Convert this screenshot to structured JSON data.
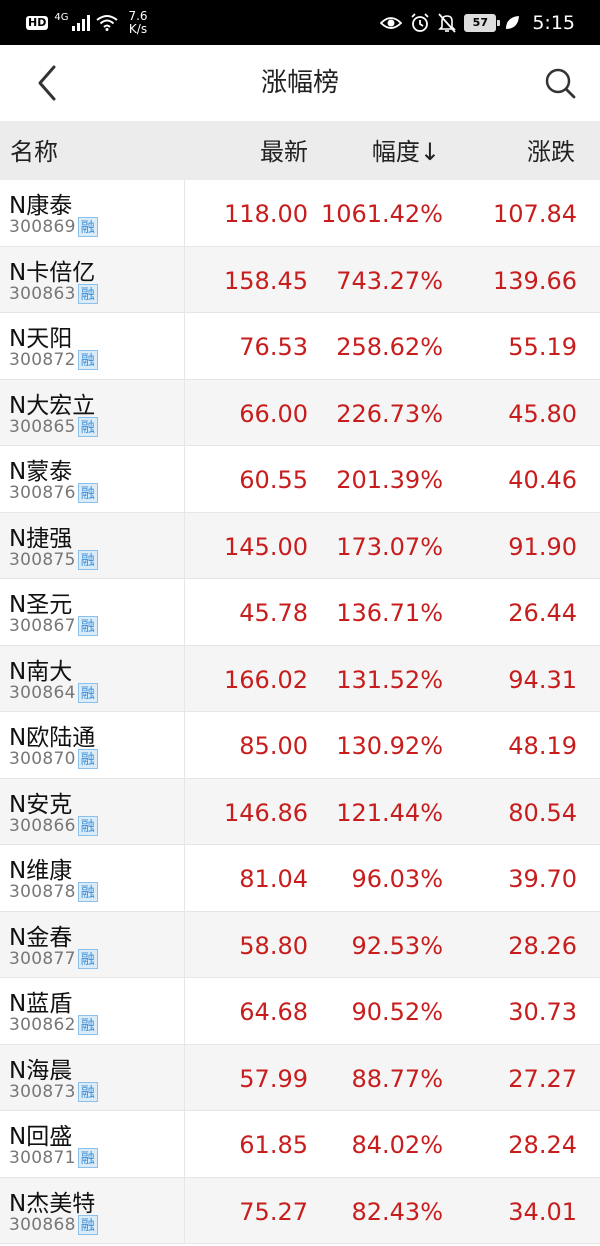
{
  "status_bar": {
    "hd": "HD",
    "network": "4G",
    "speed_value": "7.6",
    "speed_unit": "K/s",
    "battery": "57",
    "time": "5:15"
  },
  "header": {
    "title": "涨幅榜",
    "back_icon": "chevron-left-icon",
    "search_icon": "search-icon"
  },
  "columns": {
    "name": "名称",
    "latest": "最新",
    "change": "幅度↓",
    "diff": "涨跌"
  },
  "badge_label": "融",
  "rows": [
    {
      "name": "N康泰",
      "code": "300869",
      "latest": "118.00",
      "change": "1061.42%",
      "diff": "107.84"
    },
    {
      "name": "N卡倍亿",
      "code": "300863",
      "latest": "158.45",
      "change": "743.27%",
      "diff": "139.66"
    },
    {
      "name": "N天阳",
      "code": "300872",
      "latest": "76.53",
      "change": "258.62%",
      "diff": "55.19"
    },
    {
      "name": "N大宏立",
      "code": "300865",
      "latest": "66.00",
      "change": "226.73%",
      "diff": "45.80"
    },
    {
      "name": "N蒙泰",
      "code": "300876",
      "latest": "60.55",
      "change": "201.39%",
      "diff": "40.46"
    },
    {
      "name": "N捷强",
      "code": "300875",
      "latest": "145.00",
      "change": "173.07%",
      "diff": "91.90"
    },
    {
      "name": "N圣元",
      "code": "300867",
      "latest": "45.78",
      "change": "136.71%",
      "diff": "26.44"
    },
    {
      "name": "N南大",
      "code": "300864",
      "latest": "166.02",
      "change": "131.52%",
      "diff": "94.31"
    },
    {
      "name": "N欧陆通",
      "code": "300870",
      "latest": "85.00",
      "change": "130.92%",
      "diff": "48.19"
    },
    {
      "name": "N安克",
      "code": "300866",
      "latest": "146.86",
      "change": "121.44%",
      "diff": "80.54"
    },
    {
      "name": "N维康",
      "code": "300878",
      "latest": "81.04",
      "change": "96.03%",
      "diff": "39.70"
    },
    {
      "name": "N金春",
      "code": "300877",
      "latest": "58.80",
      "change": "92.53%",
      "diff": "28.26"
    },
    {
      "name": "N蓝盾",
      "code": "300862",
      "latest": "64.68",
      "change": "90.52%",
      "diff": "30.73"
    },
    {
      "name": "N海晨",
      "code": "300873",
      "latest": "57.99",
      "change": "88.77%",
      "diff": "27.27"
    },
    {
      "name": "N回盛",
      "code": "300871",
      "latest": "61.85",
      "change": "84.02%",
      "diff": "28.24"
    },
    {
      "name": "N杰美特",
      "code": "300868",
      "latest": "75.27",
      "change": "82.43%",
      "diff": "34.01"
    }
  ],
  "colors": {
    "up": "#c81d1d",
    "header_bg": "#ececec",
    "badge": "#3b8fd8"
  }
}
